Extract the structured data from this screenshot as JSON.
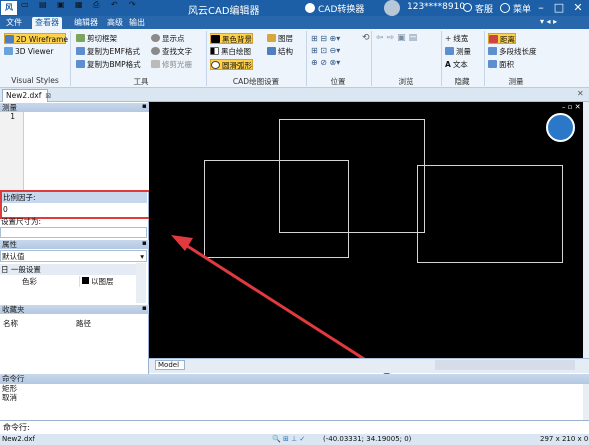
{
  "titlebar": {
    "title": "风云CAD编辑器",
    "cad_converter": "CAD转换器",
    "user_id": "123****8910",
    "help": "客服",
    "menu": "菜单"
  },
  "menu_tabs": [
    "文件",
    "查看器",
    "编辑器",
    "高级",
    "输出"
  ],
  "ribbon": {
    "visual_styles": {
      "items": [
        "2D Wireframe",
        "3D Viewer"
      ],
      "label": "Visual Styles"
    },
    "tools": {
      "items": [
        "剪切框架",
        "复制为EMF格式",
        "复制为BMP格式",
        "显示点",
        "查找文字",
        "修剪光栅"
      ],
      "label": "工具"
    },
    "cad_settings": {
      "items": [
        "黑色背景",
        "图层",
        "黑白绘图",
        "结构",
        "圆滑弧形"
      ],
      "label": "CAD绘图设置"
    },
    "position_label": "位置",
    "browse_label": "浏览",
    "hide": {
      "items": [
        "线宽",
        "测量",
        "文本"
      ],
      "label": "隐藏"
    },
    "measure": {
      "items": [
        "距离",
        "多段线长度",
        "面积"
      ],
      "label": "测量"
    }
  },
  "doc_tab": "New2.dxf",
  "left_panel": {
    "measure_title": "测量",
    "line_number": "1",
    "scale_label": "比例因子:",
    "scale_value": "0",
    "size_label": "设置尺寸为:",
    "props_title": "属性",
    "props_default": "默认值",
    "general_settings": "日 一般设置",
    "color_label": "色彩",
    "color_value": "以图层",
    "favorites_title": "收藏夹",
    "col_name": "名称",
    "col_path": "路径"
  },
  "canvas": {
    "model_tab": "Model"
  },
  "command": {
    "title": "命令行",
    "lines": [
      "矩形",
      "取消"
    ],
    "prompt": "命令行:"
  },
  "status": {
    "file": "New2.dxf",
    "coords": "(-40.03331; 34.19005; 0)",
    "page_size": "297 x 210 x 0"
  },
  "colors": {
    "accent": "#1d5fa6",
    "arrow": "#e0393e",
    "highlight": "#e03a3a"
  }
}
